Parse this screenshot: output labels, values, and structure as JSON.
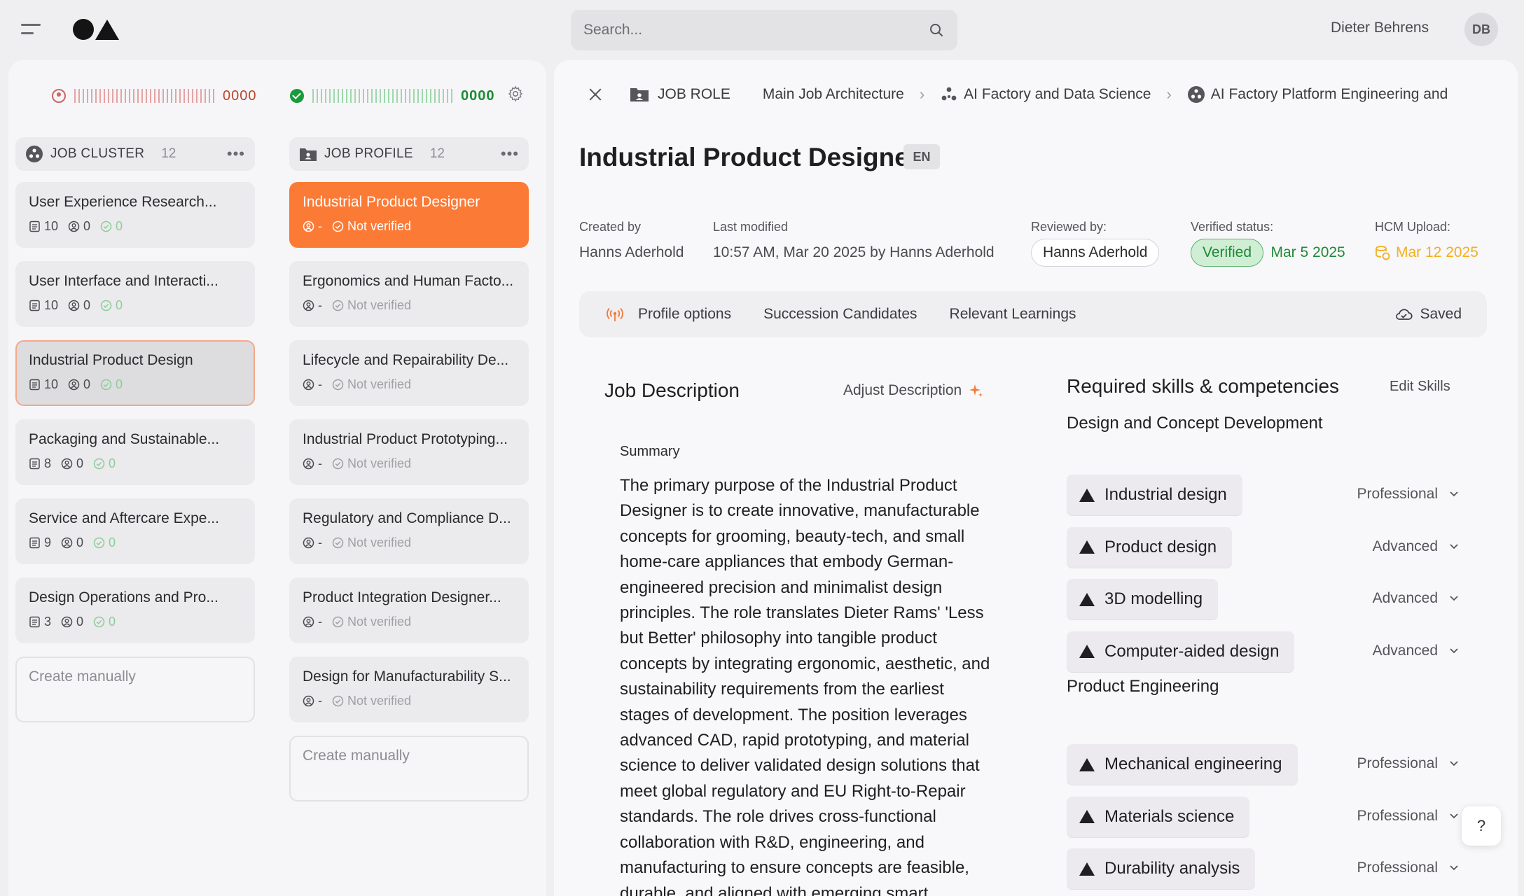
{
  "topbar": {
    "search_placeholder": "Search...",
    "user_name": "Dieter Behrens",
    "user_initials": "DB"
  },
  "progress": {
    "unverified_count": "0000",
    "verified_count": "0000",
    "unverified_color": "#b5472b",
    "verified_color": "#1a8c34"
  },
  "job_cluster": {
    "title": "JOB CLUSTER",
    "count": "12",
    "items": [
      {
        "title": "User Experience Research...",
        "docs": "10",
        "people": "0",
        "verified": "0"
      },
      {
        "title": "User Interface and Interacti...",
        "docs": "10",
        "people": "0",
        "verified": "0"
      },
      {
        "title": "Industrial Product Design",
        "docs": "10",
        "people": "0",
        "verified": "0"
      },
      {
        "title": "Packaging and Sustainable...",
        "docs": "8",
        "people": "0",
        "verified": "0"
      },
      {
        "title": "Service and Aftercare Expe...",
        "docs": "9",
        "people": "0",
        "verified": "0"
      },
      {
        "title": "Design Operations and Pro...",
        "docs": "3",
        "people": "0",
        "verified": "0"
      }
    ],
    "create_label": "Create manually"
  },
  "job_profile": {
    "title": "JOB PROFILE",
    "count": "12",
    "items": [
      {
        "title": "Industrial Product Designer",
        "people": "-",
        "status": "Not verified"
      },
      {
        "title": "Ergonomics and Human Facto...",
        "people": "-",
        "status": "Not verified"
      },
      {
        "title": "Lifecycle and Repairability De...",
        "people": "-",
        "status": "Not verified"
      },
      {
        "title": "Industrial Product Prototyping...",
        "people": "-",
        "status": "Not verified"
      },
      {
        "title": "Regulatory and Compliance D...",
        "people": "-",
        "status": "Not verified"
      },
      {
        "title": "Product Integration Designer...",
        "people": "-",
        "status": "Not verified"
      },
      {
        "title": "Design for Manufacturability S...",
        "people": "-",
        "status": "Not verified"
      }
    ],
    "create_label": "Create manually"
  },
  "breadcrumb": {
    "type_label": "JOB ROLE",
    "items": [
      "Main Job Architecture",
      "AI Factory and Data Science",
      "AI Factory Platform Engineering and"
    ]
  },
  "role": {
    "title": "Industrial Product Designer",
    "lang": "EN",
    "created_by_label": "Created by",
    "created_by": "Hanns Aderhold",
    "last_modified_label": "Last modified",
    "last_modified": "10:57 AM, Mar 20 2025  by Hanns Aderhold",
    "reviewed_by_label": "Reviewed by:",
    "reviewed_by": "Hanns Aderhold",
    "verified_status_label": "Verified status:",
    "verified_status": "Verified",
    "verified_date": "Mar 5 2025",
    "hcm_label": "HCM Upload:",
    "hcm_date": "Mar 12 2025"
  },
  "tabs": {
    "items": [
      "Profile options",
      "Succession Candidates",
      "Relevant Learnings"
    ],
    "saved_label": "Saved"
  },
  "description": {
    "title": "Job Description",
    "adjust_label": "Adjust Description",
    "summary_label": "Summary",
    "summary_text": "The primary purpose of the Industrial Product Designer is to create innovative, manufacturable concepts for grooming, beauty-tech, and small home-care appliances that embody German-engineered precision and minimalist design principles. The role translates Dieter Rams' 'Less but Better' philosophy into tangible product concepts by integrating ergonomic, aesthetic, and sustainability requirements from the earliest stages of development. The position leverages advanced CAD, rapid prototyping, and material science to deliver validated design solutions that meet global regulatory and EU Right-to-Repair standards. The role drives cross-functional collaboration with R&D, engineering, and manufacturing to ensure concepts are feasible, durable, and aligned with emerging smart"
  },
  "skills": {
    "title": "Required skills & competencies",
    "edit_label": "Edit Skills",
    "groups": [
      {
        "title": "Design and Concept Development",
        "items": [
          {
            "name": "Industrial design",
            "level": "Professional"
          },
          {
            "name": "Product design",
            "level": "Advanced"
          },
          {
            "name": "3D modelling",
            "level": "Advanced"
          },
          {
            "name": "Computer-aided design",
            "level": "Advanced"
          }
        ]
      },
      {
        "title": "Product Engineering",
        "items": [
          {
            "name": "Mechanical engineering",
            "level": "Professional"
          },
          {
            "name": "Materials science",
            "level": "Professional"
          },
          {
            "name": "Durability analysis",
            "level": "Professional"
          }
        ]
      }
    ]
  },
  "help_label": "?",
  "colors": {
    "accent": "#fb7a35",
    "verified_green": "#1f8a37",
    "hcm_yellow": "#f2b01e"
  }
}
